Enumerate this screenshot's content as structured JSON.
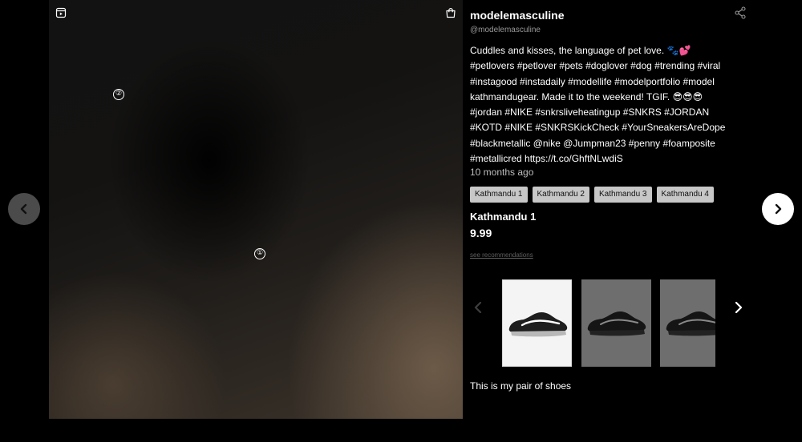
{
  "media": {
    "hotspots": [
      "②",
      "①"
    ]
  },
  "navigation": {
    "prev_icon": "chevron-left-icon",
    "next_icon": "chevron-right-icon"
  },
  "post": {
    "username": "modelemasculine",
    "handle": "@modelemasculine",
    "caption_lines": [
      "Cuddles and kisses, the language of pet love. 🐾💕",
      "#petlovers #petlover #pets #doglover #dog #trending #viral",
      "#instagood #instadaily #modellife #modelportfolio #model",
      "kathmandugear. Made it to the weekend! TGIF. 😎😎😎",
      "#jordan #NIKE #snkrsliveheatingup #SNKRS #JORDAN",
      "#KOTD #NIKE #SNKRSKickCheck #YourSneakersAreDope",
      "#blackmetallic @nike @Jumpman23 #penny #foamposite",
      "#metallicred https://t.co/GhftNLwdiS"
    ],
    "timestamp": "10 months ago"
  },
  "products": {
    "tabs": [
      "Kathmandu 1",
      "Kathmandu 2",
      "Kathmandu 3",
      "Kathmandu 4"
    ],
    "selected": {
      "name": "Kathmandu 1",
      "price": "9.99",
      "recommendations_link": "see recommendations"
    },
    "thumbnails": [
      "white-background-shoe",
      "grey-background-shoe",
      "grey-background-shoe"
    ],
    "description": "This is my pair of shoes"
  },
  "colors": {
    "background": "#000000",
    "tag_bg": "#c7c7c7",
    "thumb_selected_bg": "#f4f4f4",
    "thumb_bg": "#6e6e6e"
  }
}
